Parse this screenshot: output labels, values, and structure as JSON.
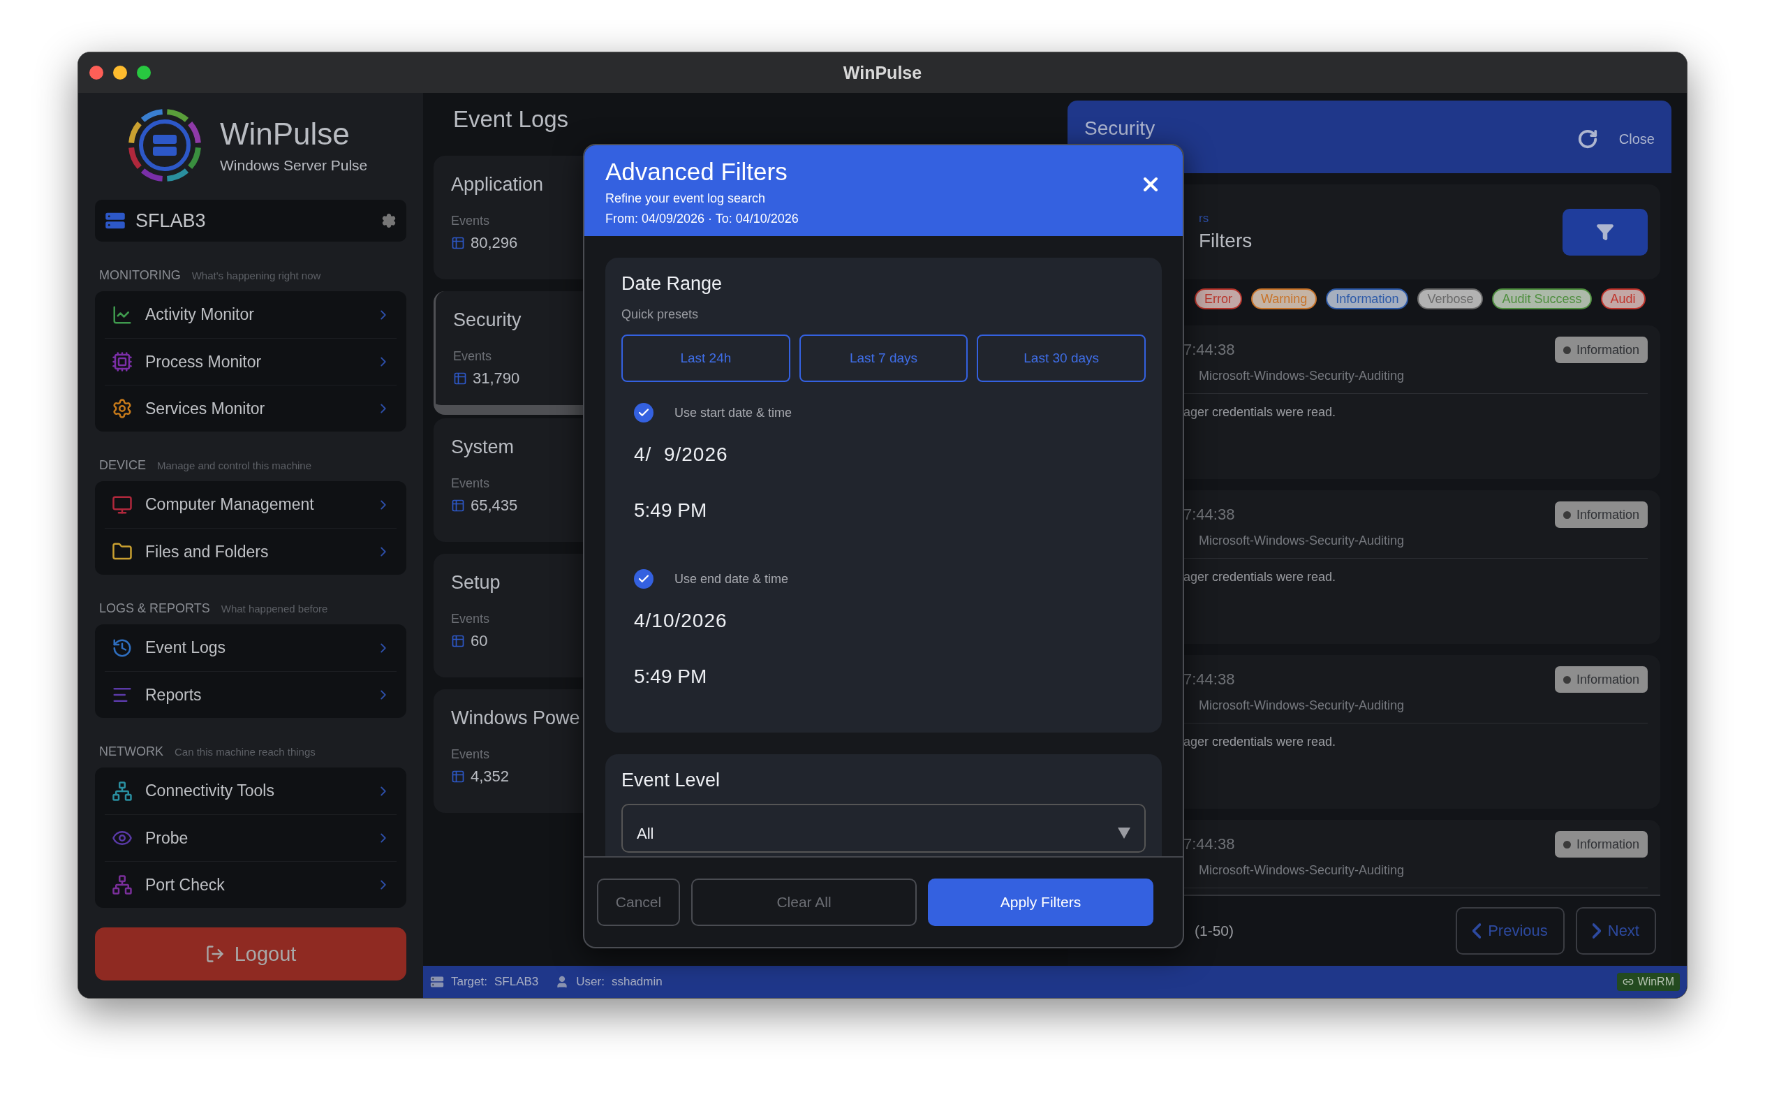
{
  "window": {
    "title": "WinPulse"
  },
  "sidebar": {
    "app_name": "WinPulse",
    "app_subtitle": "Windows Server Pulse",
    "server": "SFLAB3",
    "sections": [
      {
        "title": "MONITORING",
        "subtitle": "What's happening right now",
        "items": [
          "Activity Monitor",
          "Process Monitor",
          "Services Monitor"
        ]
      },
      {
        "title": "DEVICE",
        "subtitle": "Manage and control this machine",
        "items": [
          "Computer Management",
          "Files and Folders"
        ]
      },
      {
        "title": "LOGS & REPORTS",
        "subtitle": "What happened before",
        "items": [
          "Event Logs",
          "Reports"
        ]
      },
      {
        "title": "NETWORK",
        "subtitle": "Can this machine reach things",
        "items": [
          "Connectivity Tools",
          "Probe",
          "Port Check"
        ]
      }
    ],
    "logout": "Logout"
  },
  "event_logs": {
    "title": "Event Logs",
    "logs": [
      {
        "name": "Application",
        "events_label": "Events",
        "count": "80,296",
        "selected": false
      },
      {
        "name": "Security",
        "events_label": "Events",
        "count": "31,790",
        "selected": true
      },
      {
        "name": "System",
        "events_label": "Events",
        "count": "65,435",
        "selected": false
      },
      {
        "name": "Setup",
        "events_label": "Events",
        "count": "60",
        "selected": false
      },
      {
        "name": "Windows Powe",
        "events_label": "Events",
        "count": "4,352",
        "selected": false
      }
    ]
  },
  "detail": {
    "title": "Security",
    "close": "Close",
    "filters_hint": "rs",
    "filters_title": "Filters",
    "chips": [
      {
        "label": "Error",
        "color": "#b8352c"
      },
      {
        "label": "Warning",
        "color": "#c8742a"
      },
      {
        "label": "Information",
        "color": "#2d5aa8"
      },
      {
        "label": "Verbose",
        "color": "#6a6a6a"
      },
      {
        "label": "Audit Success",
        "color": "#4f8f3f"
      },
      {
        "label": "Audi",
        "color": "#c0342c"
      }
    ],
    "events": [
      {
        "time": "7:44:38",
        "level": "Information",
        "source": "Microsoft-Windows-Security-Auditing",
        "message": "ager credentials were read."
      },
      {
        "time": "7:44:38",
        "level": "Information",
        "source": "Microsoft-Windows-Security-Auditing",
        "message": "ager credentials were read."
      },
      {
        "time": "7:44:38",
        "level": "Information",
        "source": "Microsoft-Windows-Security-Auditing",
        "message": "ager credentials were read."
      },
      {
        "time": "7:44:38",
        "level": "Information",
        "source": "Microsoft-Windows-Security-Auditing"
      }
    ],
    "range": "(1-50)",
    "previous": "Previous",
    "next": "Next"
  },
  "modal": {
    "title": "Advanced Filters",
    "subtitle": "Refine your event log search",
    "range": "From: 04/09/2026 · To: 04/10/2026",
    "date_range": {
      "title": "Date Range",
      "presets_label": "Quick presets",
      "presets": [
        "Last 24h",
        "Last 7 days",
        "Last 30 days"
      ],
      "start": {
        "label": "Use start date & time",
        "checked": true,
        "date": "4/  9/2026",
        "time": "5:49 PM"
      },
      "end": {
        "label": "Use end date & time",
        "checked": true,
        "date": "4/10/2026",
        "time": "5:49 PM"
      }
    },
    "event_level": {
      "title": "Event Level",
      "value": "All"
    },
    "buttons": {
      "cancel": "Cancel",
      "clear": "Clear All",
      "apply": "Apply Filters"
    }
  },
  "status_bar": {
    "target_label": "Target:",
    "target": "SFLAB3",
    "user_label": "User:",
    "user": "sshadmin",
    "connection": "WinRM"
  }
}
